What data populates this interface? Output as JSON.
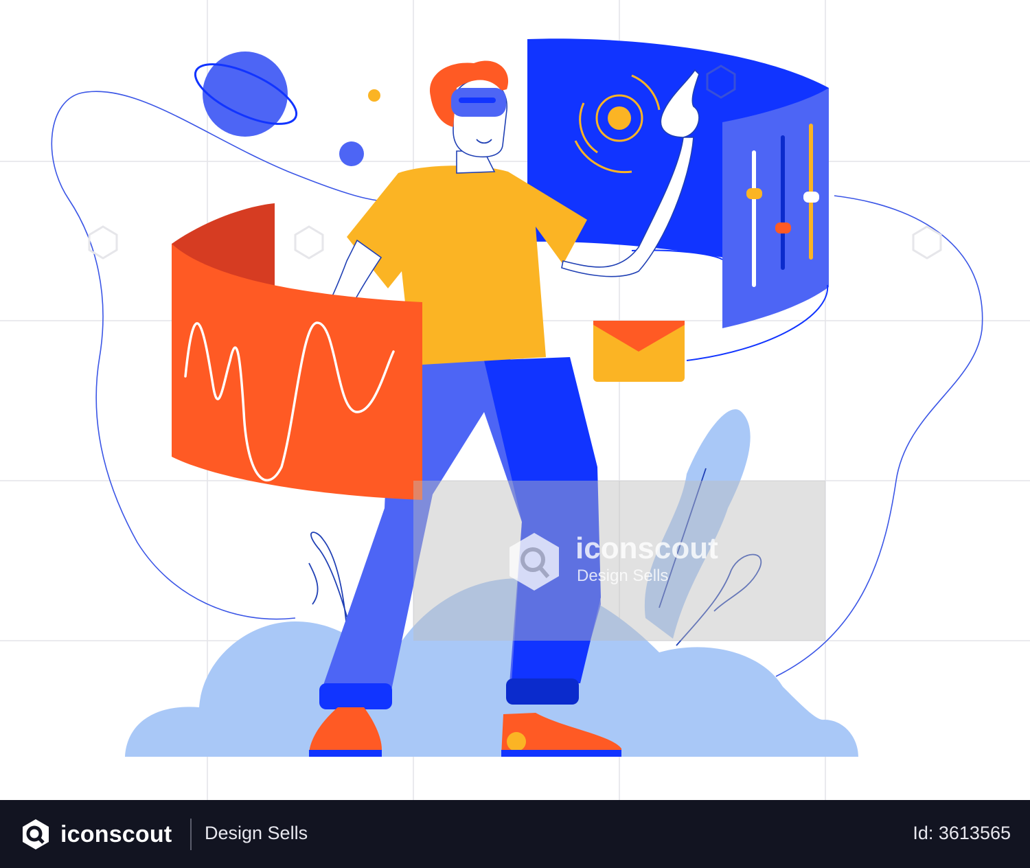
{
  "watermark": {
    "brand": "iconscout",
    "tagline": "Design Sells"
  },
  "footer": {
    "brand": "iconscout",
    "tagline": "Design Sells",
    "asset_id": "Id: 3613565"
  },
  "colors": {
    "blue_primary": "#1134ff",
    "blue_mid": "#4d65f5",
    "blue_light": "#a9c8f7",
    "orange": "#ff5a24",
    "orange_dark": "#d63c22",
    "yellow": "#fbb424",
    "hair": "#ff5a24",
    "footer_bg": "#121421"
  },
  "icons": [
    "planet-icon",
    "envelope-icon",
    "slider-controls-icon",
    "target-icon",
    "wave-chart-icon",
    "iconscout-logo-icon"
  ]
}
